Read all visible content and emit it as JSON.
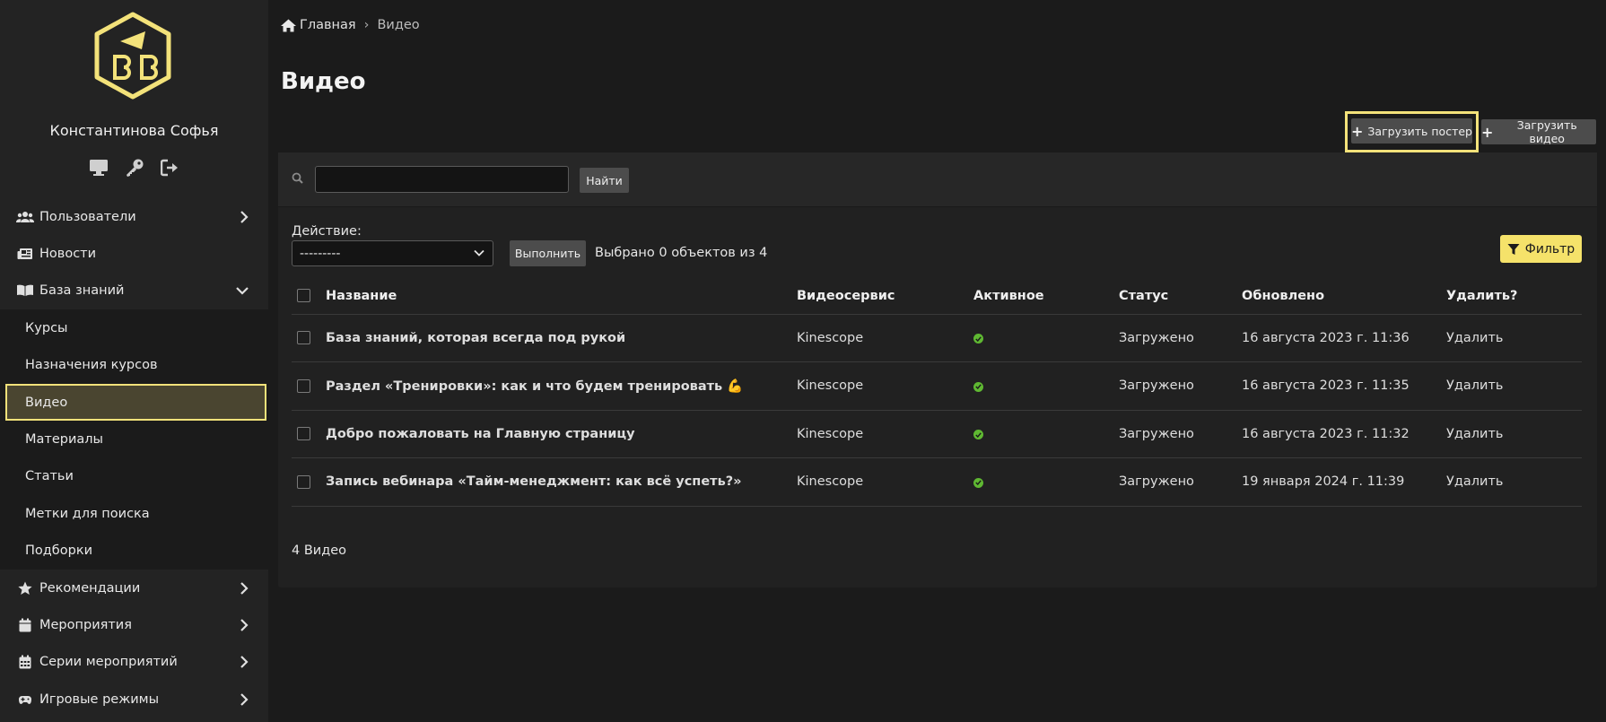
{
  "sidebar": {
    "user_name": "Константинова Софья",
    "user_icons": [
      "monitor-icon",
      "key-icon",
      "sign-out-icon"
    ],
    "items": [
      {
        "label": "Пользователи",
        "icon": "users-icon"
      },
      {
        "label": "Новости",
        "icon": "newspaper-icon"
      },
      {
        "label": "База знаний",
        "icon": "book-icon"
      },
      {
        "label": "Курсы"
      },
      {
        "label": "Назначения курсов"
      },
      {
        "label": "Видео"
      },
      {
        "label": "Материалы"
      },
      {
        "label": "Статьи"
      },
      {
        "label": "Метки для поиска"
      },
      {
        "label": "Подборки"
      },
      {
        "label": "Рекомендации",
        "icon": "star-icon"
      },
      {
        "label": "Мероприятия",
        "icon": "calendar-icon"
      },
      {
        "label": "Серии мероприятий",
        "icon": "calendar-grid-icon"
      },
      {
        "label": "Игровые режимы",
        "icon": "gamepad-icon"
      }
    ]
  },
  "breadcrumb": {
    "home": "Главная",
    "separator": "›",
    "current": "Видео"
  },
  "page": {
    "title": "Видео"
  },
  "toolbar": {
    "upload_poster": "Загрузить постер",
    "upload_video": "Загрузить видео"
  },
  "search": {
    "value": "",
    "button": "Найти"
  },
  "actions": {
    "label": "Действие:",
    "selected": "---------",
    "run": "Выполнить",
    "selected_info": "Выбрано 0 объектов из 4",
    "filter": "Фильтр"
  },
  "table": {
    "columns": [
      "Название",
      "Видеосервис",
      "Активное",
      "Статус",
      "Обновлено",
      "Удалить?"
    ],
    "rows": [
      {
        "name": "База знаний, которая всегда под рукой",
        "service": "Kinescope",
        "status": "Загружено",
        "updated": "16 августа 2023 г. 11:36",
        "delete": "Удалить"
      },
      {
        "name": "Раздел «Тренировки»: как и что будем тренировать 💪",
        "service": "Kinescope",
        "status": "Загружено",
        "updated": "16 августа 2023 г. 11:35",
        "delete": "Удалить"
      },
      {
        "name": "Добро пожаловать на Главную страницу",
        "service": "Kinescope",
        "status": "Загружено",
        "updated": "16 августа 2023 г. 11:32",
        "delete": "Удалить"
      },
      {
        "name": "Запись вебинара «Тайм-менеджмент: как всё успеть?»",
        "service": "Kinescope",
        "status": "Загружено",
        "updated": "19 января 2024 г. 11:39",
        "delete": "Удалить"
      }
    ],
    "footer": "4 Видео"
  },
  "colors": {
    "accent": "#f5e26a",
    "highlight_border": "#f3e27a",
    "arrow": "#e0334f",
    "active_green": "#5fb832"
  }
}
